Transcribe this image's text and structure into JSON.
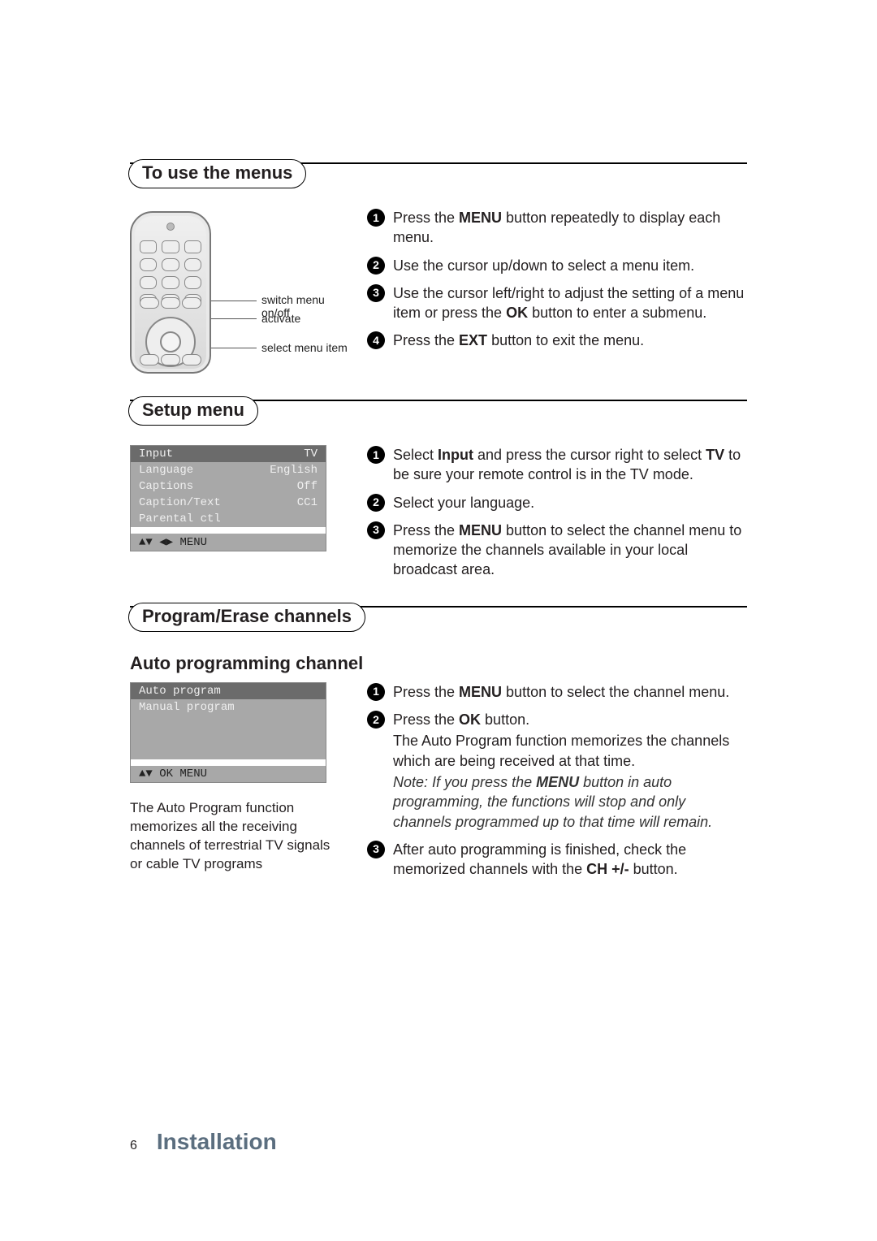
{
  "sections": {
    "use_menus": {
      "heading": "To use the menus",
      "remote_labels": {
        "switch": "switch menu on/off",
        "activate": "activate",
        "select": "select menu item"
      },
      "steps": [
        {
          "n": "1",
          "pre": "Press the ",
          "bold": "MENU",
          "post": " button repeatedly to display each menu."
        },
        {
          "n": "2",
          "text": "Use the cursor up/down to select a menu item."
        },
        {
          "n": "3",
          "pre": "Use the cursor left/right to adjust the setting of a menu item or press the ",
          "bold": "OK",
          "post": " button to enter a submenu."
        },
        {
          "n": "4",
          "pre": "Press the ",
          "bold": "EXT",
          "post": " button to exit the menu."
        }
      ]
    },
    "setup_menu": {
      "heading": "Setup menu",
      "osd": {
        "rows": [
          {
            "label": "Input",
            "value": "TV",
            "selected": true
          },
          {
            "label": "Language",
            "value": "English"
          },
          {
            "label": "Captions",
            "value": "Off"
          },
          {
            "label": "Caption/Text",
            "value": "CC1"
          },
          {
            "label": "Parental ctl",
            "value": ""
          }
        ],
        "footer": "▲▼ ◀▶  MENU"
      },
      "steps": [
        {
          "n": "1",
          "segments": [
            {
              "t": "Select "
            },
            {
              "b": "Input"
            },
            {
              "t": " and press the cursor right to select "
            },
            {
              "b": "TV"
            },
            {
              "t": " to be sure your remote control is in the TV mode."
            }
          ]
        },
        {
          "n": "2",
          "text": "Select your language."
        },
        {
          "n": "3",
          "segments": [
            {
              "t": "Press the "
            },
            {
              "b": "MENU"
            },
            {
              "t": " button to select the channel menu to memorize the channels available in your local broadcast area."
            }
          ]
        }
      ]
    },
    "program": {
      "heading": "Program/Erase channels",
      "subheading": "Auto programming channel",
      "osd": {
        "rows": [
          {
            "label": "Auto program",
            "value": "",
            "selected": true
          },
          {
            "label": "Manual program",
            "value": ""
          }
        ],
        "footer": "▲▼ OK MENU"
      },
      "desc": "The Auto Program function memorizes all the receiving channels of terrestrial TV signals or cable TV programs",
      "steps": [
        {
          "n": "1",
          "segments": [
            {
              "t": "Press the "
            },
            {
              "b": "MENU"
            },
            {
              "t": " button to select the channel menu."
            }
          ]
        },
        {
          "n": "2",
          "segments": [
            {
              "t": "Press the "
            },
            {
              "b": "OK"
            },
            {
              "t": " button."
            }
          ],
          "extra": "The Auto Program function memorizes the channels which are being received at that time.",
          "note_segments": [
            {
              "t": "Note: If you press the "
            },
            {
              "b": "MENU"
            },
            {
              "t": " button in auto programming, the functions will stop and only channels programmed up to that time will remain."
            }
          ]
        },
        {
          "n": "3",
          "segments": [
            {
              "t": "After auto programming is finished, check the memorized channels with the "
            },
            {
              "b": "CH +/-"
            },
            {
              "t": " button."
            }
          ]
        }
      ]
    }
  },
  "footer": {
    "page": "6",
    "title": "Installation"
  }
}
